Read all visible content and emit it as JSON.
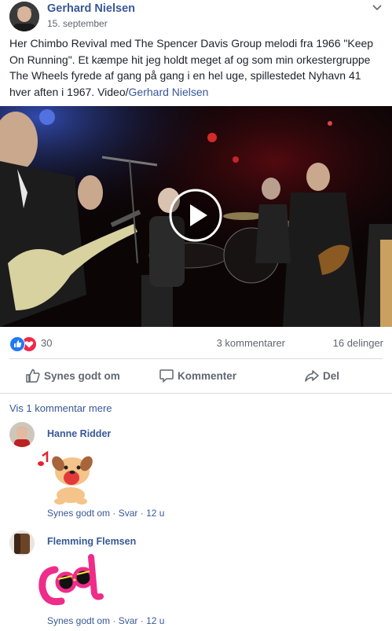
{
  "post": {
    "author": "Gerhard Nielsen",
    "date": "15. september",
    "text": "Her Chimbo Revival med The Spencer Davis Group melodi fra 1966 \"Keep On Running\". Et kæmpe hit jeg holdt meget af og som min orkestergruppe The Wheels fyrede af gang på gang i en hel uge, spillestedet Nyhavn 41 hver aften i 1967. Video/",
    "text_link": "Gerhard Nielsen"
  },
  "reactions": {
    "count": "30",
    "comments": "3 kommentarer",
    "shares": "16 delinger",
    "icons": [
      "like-icon",
      "love-icon"
    ]
  },
  "actions": {
    "like": "Synes godt om",
    "comment": "Kommenter",
    "share": "Del"
  },
  "more_comments": "Vis 1 kommentar mere",
  "comments": [
    {
      "name": "Hanne Ridder",
      "like": "Synes godt om",
      "sep1": " · ",
      "reply": "Svar",
      "sep2": " · ",
      "time": "12 u",
      "sticker": "dancing-puppy-sticker"
    },
    {
      "name": "Flemming Flemsen",
      "like": "Synes godt om",
      "sep1": " · ",
      "reply": "Svar",
      "sep2": " · ",
      "time": "12 u",
      "sticker": "cool-text-sticker"
    }
  ],
  "colors": {
    "link": "#385898",
    "muted": "#606770",
    "like_blue": "#2078f4",
    "love_red": "#f0284a"
  }
}
